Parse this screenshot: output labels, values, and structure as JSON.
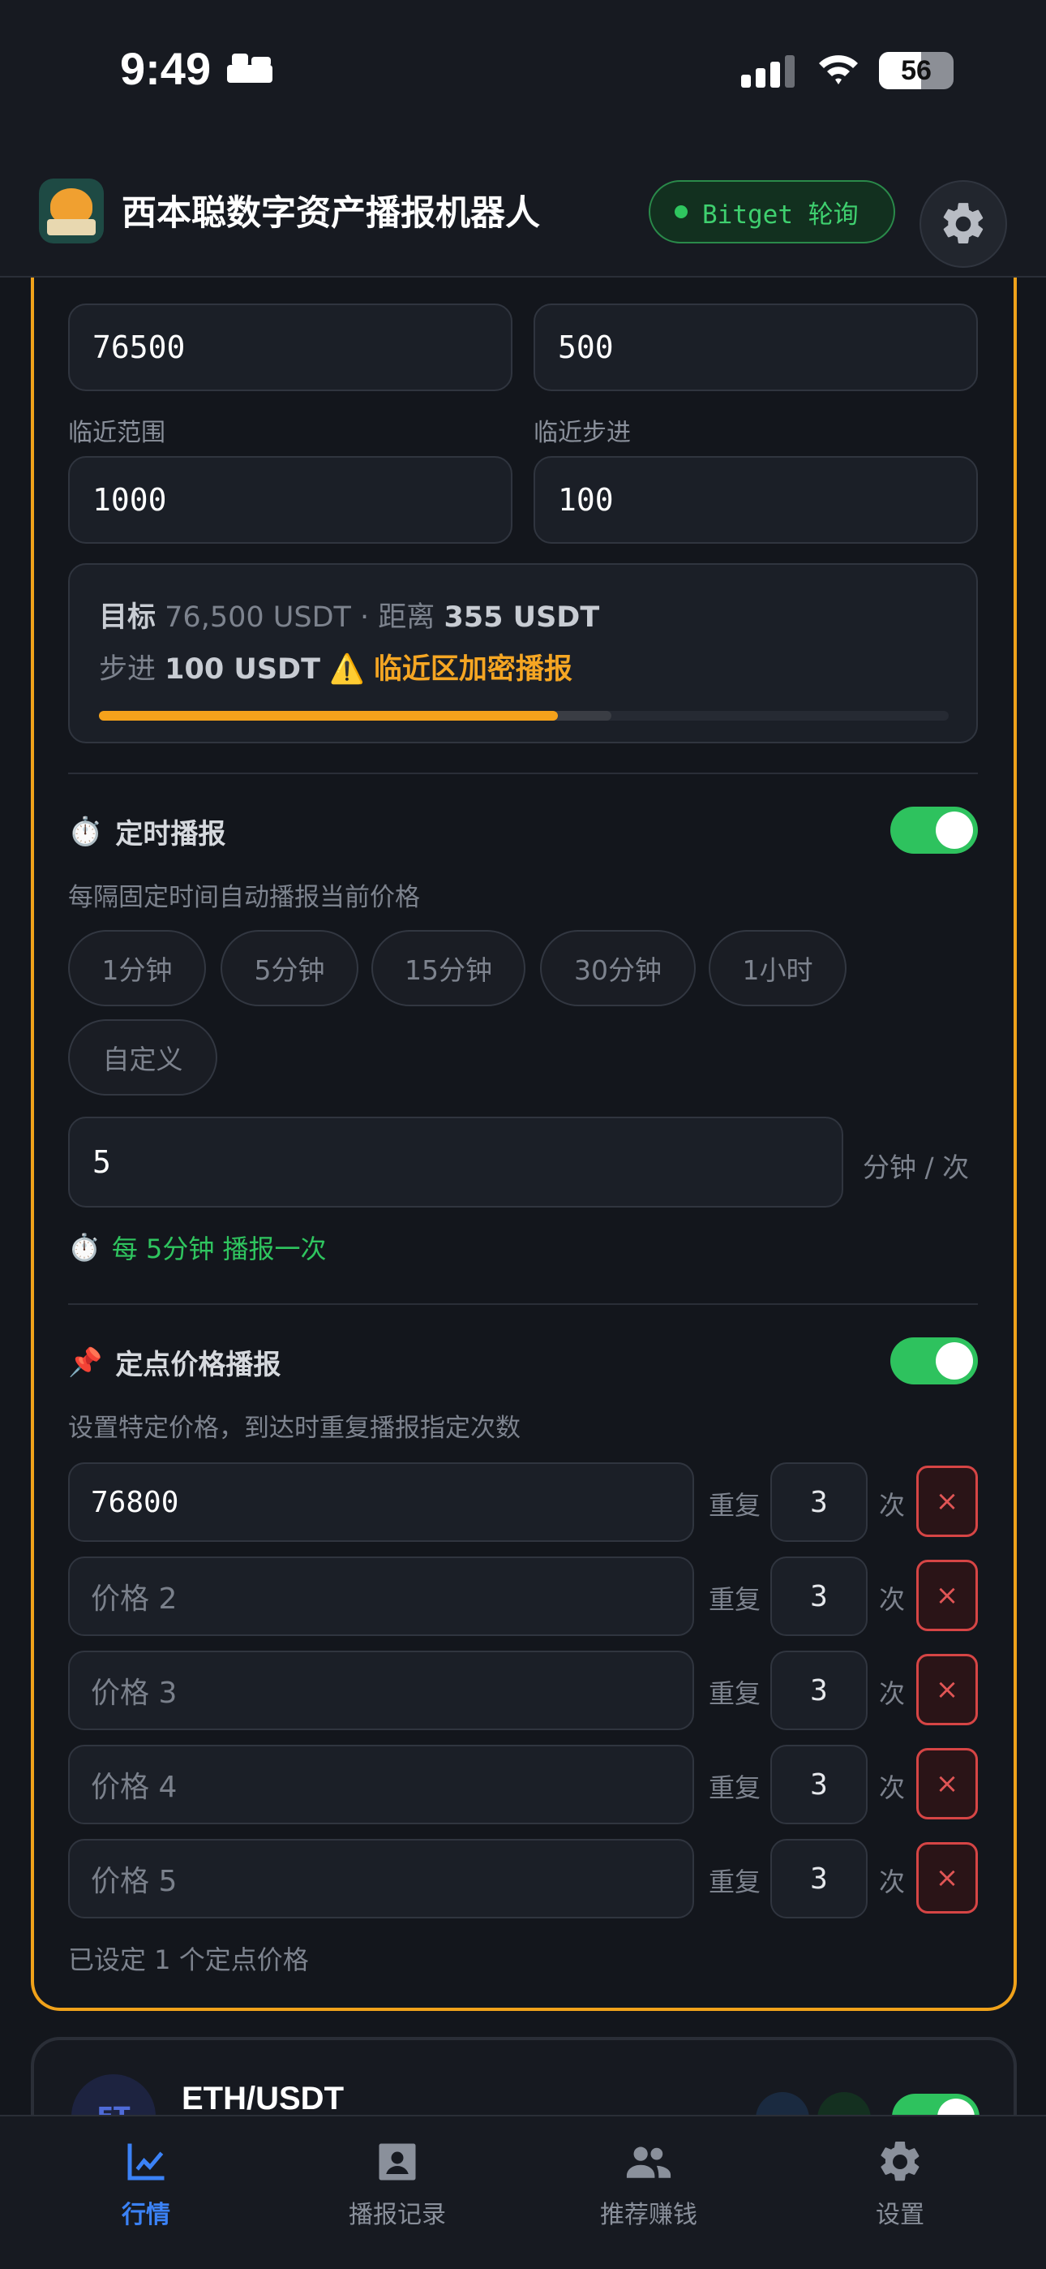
{
  "status_bar": {
    "time": "9:49",
    "battery": "56",
    "battery_level": 0.56
  },
  "header": {
    "title": "西本聪数字资产播报机器人",
    "exchange_pill": "Bitget 轮询"
  },
  "target": {
    "target_value": "76500",
    "far_step_value": "500",
    "near_range_label": "临近范围",
    "near_range_value": "1000",
    "near_step_label": "临近步进",
    "near_step_value": "100"
  },
  "summary": {
    "target_label": "目标",
    "target_text": "76,500 USDT · 距离",
    "distance": "355 USDT",
    "step_label": "步进",
    "step_value": "100 USDT",
    "zone_text": "临近区加密播报",
    "progress": 0.54
  },
  "timed": {
    "title": "定时播报",
    "description": "每隔固定时间自动播报当前价格",
    "options": [
      "1分钟",
      "5分钟",
      "15分钟",
      "30分钟",
      "1小时",
      "自定义"
    ],
    "interval_value": "5",
    "unit": "分钟 / 次",
    "hint": "每 5分钟 播报一次",
    "enabled": true
  },
  "price_alert": {
    "title": "定点价格播报",
    "description": "设置特定价格，到达时重复播报指定次数",
    "repeat_label": "重复",
    "times_label": "次",
    "rows": [
      {
        "value": "76800",
        "placeholder": "",
        "count": "3"
      },
      {
        "value": "",
        "placeholder": "价格 2",
        "count": "3"
      },
      {
        "value": "",
        "placeholder": "价格 3",
        "count": "3"
      },
      {
        "value": "",
        "placeholder": "价格 4",
        "count": "3"
      },
      {
        "value": "",
        "placeholder": "价格 5",
        "count": "3"
      }
    ],
    "delete_label": "×",
    "footer": "已设定 1 个定点价格",
    "enabled": true
  },
  "next_card": {
    "avatar": "ET",
    "pair": "ETH/USDT"
  },
  "tabs": [
    {
      "label": "行情",
      "active": true
    },
    {
      "label": "播报记录",
      "active": false
    },
    {
      "label": "推荐赚钱",
      "active": false
    },
    {
      "label": "设置",
      "active": false
    }
  ],
  "colors": {
    "accent": "#f0a21a",
    "green": "#2fc55f",
    "blue": "#3b82f6",
    "danger": "#d64545"
  }
}
